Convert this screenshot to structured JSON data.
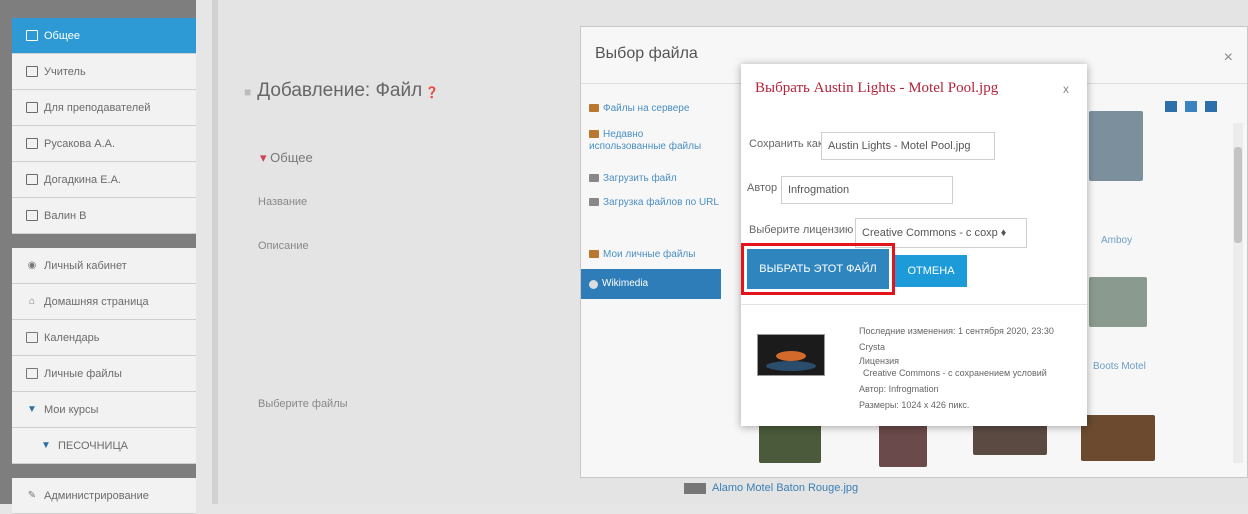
{
  "sidebar": {
    "items": [
      {
        "label": "Общее",
        "icon": "folder-icon"
      },
      {
        "label": "Учитель",
        "icon": "folder-icon"
      },
      {
        "label": "Для преподавателей",
        "icon": "folder-icon"
      },
      {
        "label": "Русакова А.А.",
        "icon": "folder-icon"
      },
      {
        "label": "Догадкина Е.А.",
        "icon": "folder-icon"
      },
      {
        "label": "Валин В",
        "icon": "folder-icon"
      },
      {
        "label": "Личный кабинет",
        "icon": "dashboard-icon"
      },
      {
        "label": "Домашняя страница",
        "icon": "home-icon"
      },
      {
        "label": "Календарь",
        "icon": "calendar-icon"
      },
      {
        "label": "Личные файлы",
        "icon": "file-icon"
      },
      {
        "label": "Мои курсы",
        "icon": "graduation-cap-icon"
      },
      {
        "label": "ПЕСОЧНИЦА",
        "icon": "graduation-cap-icon"
      },
      {
        "label": "Администрирование",
        "icon": "wrench-icon"
      }
    ],
    "active_color": "#2d9ad6"
  },
  "page": {
    "title": "Добавление: Файл",
    "section": "Общее",
    "labels": {
      "name": "Название",
      "description": "Описание",
      "select_files": "Выберите файлы"
    },
    "bottom_file": "Alamo Motel Baton Rouge.jpg"
  },
  "picker": {
    "title": "Выбор файла",
    "close": "×",
    "repos": [
      {
        "label": "Файлы на сервере"
      },
      {
        "label": "Недавно использованные файлы"
      },
      {
        "label": "Загрузить файл"
      },
      {
        "label": "Загрузка файлов по URL"
      },
      {
        "label": "Мои личные файлы"
      },
      {
        "label": "Wikimedia"
      }
    ],
    "thumb_labels": {
      "t1": "Amboy",
      "t2": "Boots Motel"
    }
  },
  "dialog": {
    "title": "Выбрать Austin Lights - Motel Pool.jpg",
    "close": "x",
    "save_as_label": "Сохранить как",
    "save_as_value": "Austin Lights - Motel Pool.jpg",
    "author_label": "Автор",
    "author_value": "Infrogmation",
    "license_label": "Выберите лицензию",
    "license_value": "Creative Commons - с сохр ♦",
    "select_button": "ВЫБРАТЬ ЭТОТ ФАЙЛ",
    "cancel_button": "ОТМЕНА",
    "meta": {
      "modified": "Последние изменения: 1 сентября 2020, 23:30",
      "source": "Crysta",
      "license_label": "Лицензия",
      "license": "Creative Commons - с сохранением условий",
      "author": "Автор: Infrogmation",
      "size": "Размеры: 1024 x 426 пикс."
    },
    "accent_red": "#e3141b",
    "button_blue": "#2f86bf",
    "cancel_blue": "#1d9bd8"
  }
}
